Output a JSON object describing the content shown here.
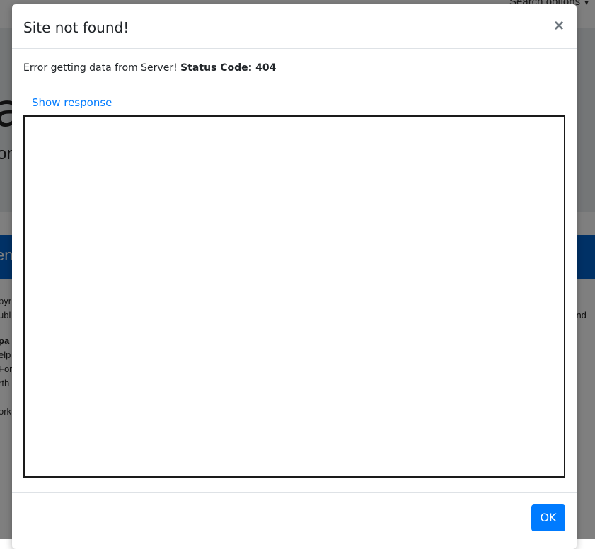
{
  "background": {
    "search_label": "Search options",
    "hero_title": "a",
    "hero_sub": "on",
    "blue_bar_text": "en",
    "text_lines": [
      "pyr",
      "ubl",
      "pa",
      "elp",
      "For",
      "rth",
      "ork"
    ],
    "right_text": "t und"
  },
  "modal": {
    "title": "Site not found!",
    "close_symbol": "×",
    "error_text": "Error getting data from Server!",
    "status_label": "Status Code: 404",
    "show_response_label": "Show response",
    "ok_label": "OK"
  },
  "colors": {
    "link": "#007bff",
    "primary_button": "#007bff",
    "banner": "#0062cc"
  }
}
